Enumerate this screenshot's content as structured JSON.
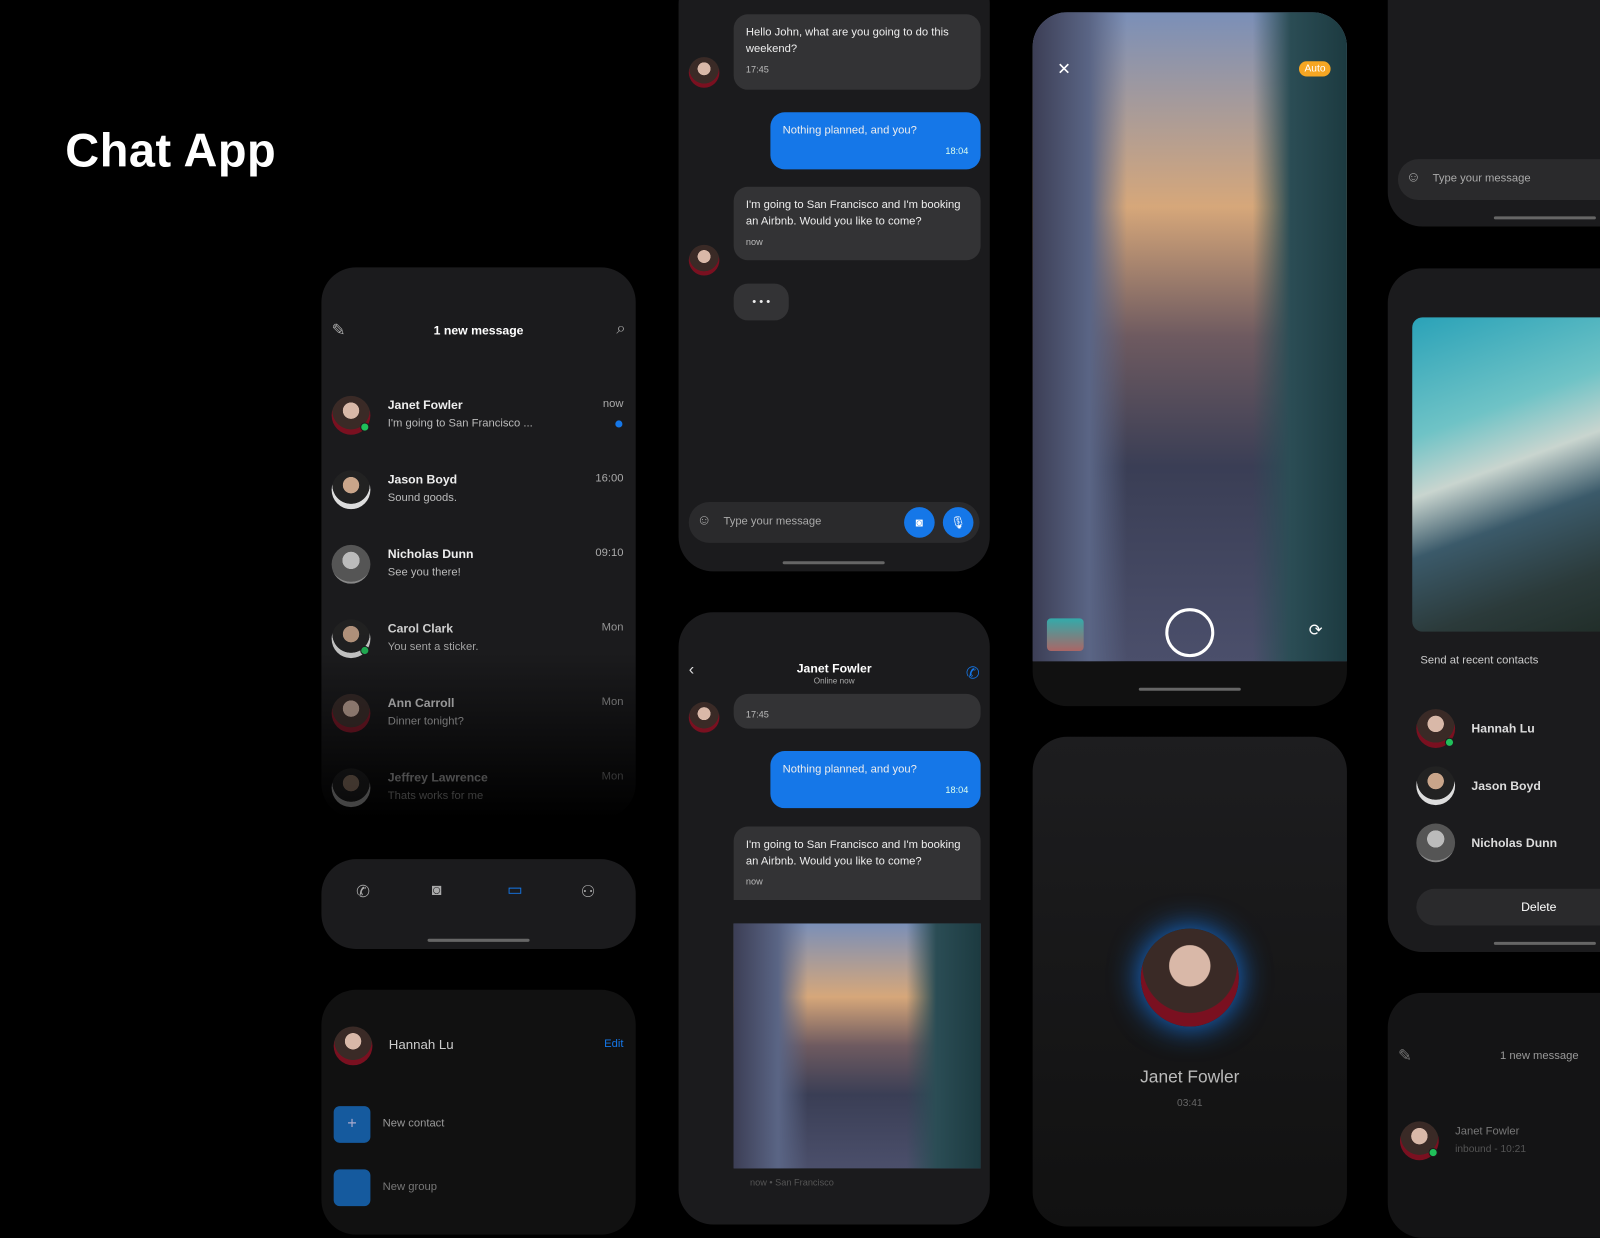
{
  "title": "Chat App",
  "accent": "#1577e8",
  "online_color": "#20c05a",
  "list": {
    "header": "1 new message",
    "items": [
      {
        "name": "Janet Fowler",
        "preview": "I'm going to San Francisco ...",
        "time": "now",
        "online": true,
        "unread": true
      },
      {
        "name": "Jason Boyd",
        "preview": "Sound goods.",
        "time": "16:00"
      },
      {
        "name": "Nicholas Dunn",
        "preview": "See you there!",
        "time": "09:10"
      },
      {
        "name": "Carol Clark",
        "preview": "You sent a sticker.",
        "time": "Mon",
        "online": true
      },
      {
        "name": "Ann Carroll",
        "preview": "Dinner tonight?",
        "time": "Mon"
      },
      {
        "name": "Jeffrey Lawrence",
        "preview": "Thats works for me",
        "time": "Mon"
      }
    ],
    "tabs": [
      "phone-icon",
      "camera-icon",
      "chat-icon",
      "contacts-icon"
    ]
  },
  "menu": {
    "user": "Hannah Lu",
    "edit": "Edit",
    "items": [
      "New contact",
      "New group"
    ]
  },
  "chat1": {
    "messages": [
      {
        "text": "Hello John, what are you going to do this weekend?",
        "time": "17:45"
      },
      {
        "text": "Nothing planned, and you?",
        "time": "18:04",
        "me": true
      },
      {
        "text": "I'm going to San Francisco and I'm booking an Airbnb. Would you like to come?",
        "time": "now"
      }
    ],
    "typing": "• • •",
    "placeholder": "Type your message"
  },
  "chat2": {
    "name": "Janet Fowler",
    "status": "Online now",
    "messages": [
      {
        "time": "17:45"
      },
      {
        "text": "Nothing planned, and you?",
        "time": "18:04",
        "me": true
      },
      {
        "text": "I'm going to San Francisco and I'm booking an Airbnb. Would you like to come?",
        "time": "now"
      }
    ],
    "photo_caption": "now • San Francisco"
  },
  "camera": {
    "flash": "Auto"
  },
  "call": {
    "name": "Janet Fowler",
    "duration": "03:41"
  },
  "share_top": {
    "placeholder": "Type your message"
  },
  "share": {
    "label": "Send at recent contacts",
    "contacts": [
      {
        "name": "Hannah Lu",
        "online": true
      },
      {
        "name": "Jason Boyd"
      },
      {
        "name": "Nicholas Dunn"
      }
    ],
    "delete": "Delete"
  },
  "list2": {
    "header": "1 new message",
    "item": {
      "name": "Janet Fowler",
      "preview": "inbound - 10:21"
    }
  }
}
